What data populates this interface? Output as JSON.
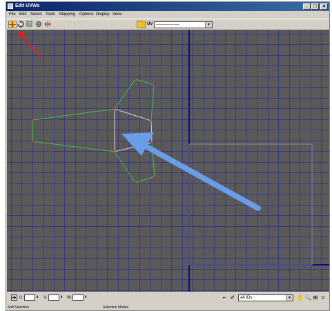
{
  "window": {
    "title": "Edit UVWs",
    "minimize": "_",
    "maximize": "□",
    "close": "×"
  },
  "menu": [
    "File",
    "Edit",
    "Select",
    "Tools",
    "Mapping",
    "Options",
    "Display",
    "View"
  ],
  "toolbar": {
    "tools": [
      {
        "icon": "move-icon",
        "active": true
      },
      {
        "icon": "rotate-icon",
        "active": false
      },
      {
        "icon": "scale-icon",
        "active": false
      },
      {
        "icon": "freeform-icon",
        "active": false
      },
      {
        "icon": "mirror-icon",
        "active": false
      }
    ],
    "uv_label": "UV",
    "map_dropdown_value": "-----------------"
  },
  "statusbar": {
    "u_label": "U:",
    "v_label": "V:",
    "w_label": "W:",
    "ids_dropdown": "All IDs"
  },
  "bottom": {
    "soft_selection": "Soft Selection",
    "selection_modes": "Selection Modes"
  },
  "colors": {
    "grid_bg": "#5a5a5a",
    "grid_line": "#1a1aa0",
    "uv_border": "#7a7a8a",
    "edges": "#40c040",
    "selected_edges": "#e8d0d0",
    "vertex": "#e02020",
    "arrow_blue": "#6a9ce8",
    "arrow_red": "#e02020"
  }
}
